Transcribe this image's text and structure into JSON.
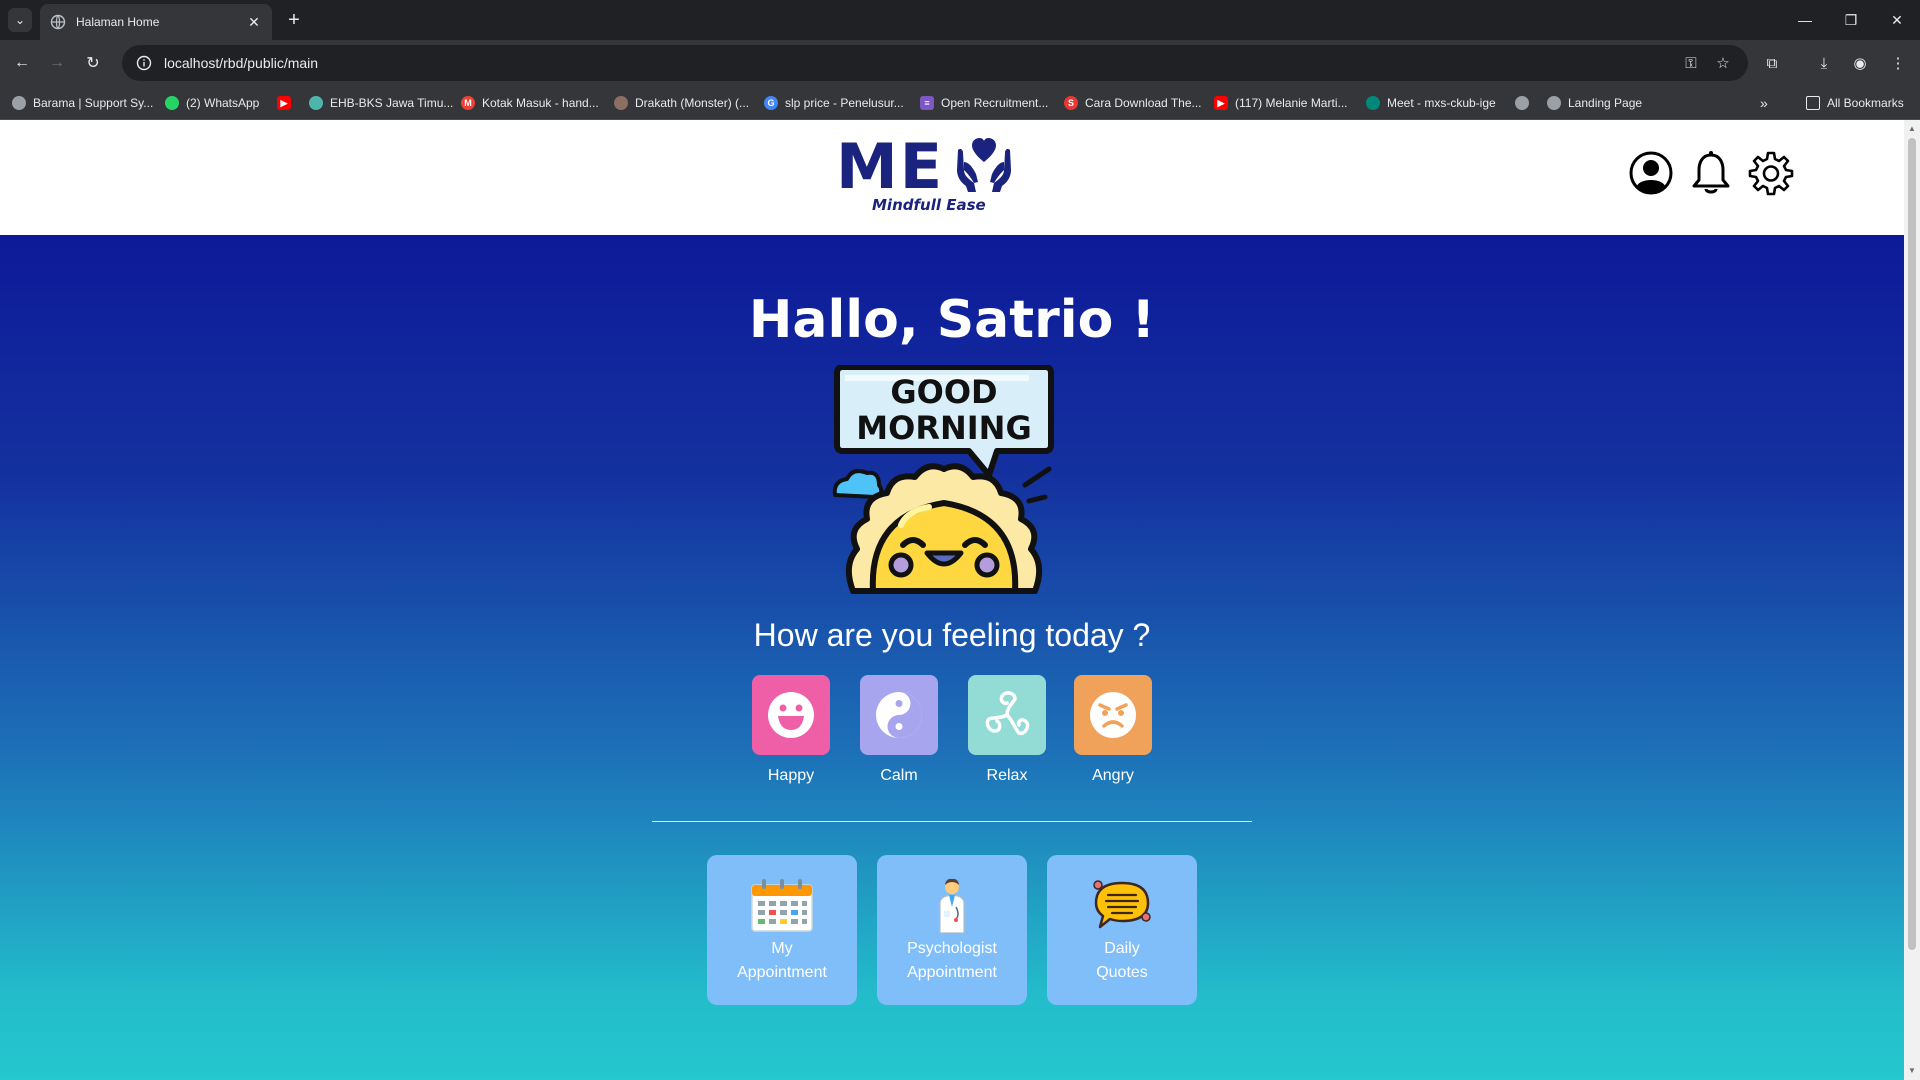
{
  "browser": {
    "tab_title": "Halaman Home",
    "new_tab": "+",
    "url": "localhost/rbd/public/main",
    "bookmarks": [
      {
        "label": "Barama | Support Sy...",
        "color": "#9aa0a6"
      },
      {
        "label": "(2) WhatsApp",
        "color": "#25d366"
      },
      {
        "label": "",
        "color": "#ff0000"
      },
      {
        "label": "EHB-BKS Jawa Timu...",
        "color": "#4db6ac"
      },
      {
        "label": "Kotak Masuk - hand...",
        "color": "#ea4335"
      },
      {
        "label": "Drakath (Monster) (...",
        "color": "#8d6e63"
      },
      {
        "label": "slp price - Penelusur...",
        "color": "#4285f4"
      },
      {
        "label": "Open Recruitment...",
        "color": "#7e57c2"
      },
      {
        "label": "Cara Download The...",
        "color": "#e53935"
      },
      {
        "label": "(117) Melanie Marti...",
        "color": "#ff0000"
      },
      {
        "label": "Meet - mxs-ckub-ige",
        "color": "#00897b"
      },
      {
        "label": "",
        "color": "#9aa0a6"
      },
      {
        "label": "Landing Page",
        "color": "#9aa0a6"
      }
    ],
    "bookmarks_overflow": "»",
    "all_bookmarks": "All Bookmarks"
  },
  "header": {
    "logo_text": "ME",
    "logo_tagline": "Mindfull Ease",
    "icons": [
      "user-icon",
      "bell-icon",
      "gear-icon"
    ],
    "brand_color": "#1a237e"
  },
  "main": {
    "greeting": "Hallo, Satrio !",
    "illustration_text": [
      "GOOD",
      "MORNING"
    ],
    "question": "How are you feeling today ?",
    "moods": [
      {
        "label": "Happy",
        "color": "#ee5fa7",
        "icon": "smile-icon"
      },
      {
        "label": "Calm",
        "color": "#a7a5ee",
        "icon": "yin-yang-icon"
      },
      {
        "label": "Relax",
        "color": "#93dcd6",
        "icon": "triskelion-icon"
      },
      {
        "label": "Angry",
        "color": "#f0a25a",
        "icon": "angry-face-icon"
      }
    ],
    "menu": [
      {
        "line1": "My",
        "line2": "Appointment",
        "icon": "calendar-icon"
      },
      {
        "line1": "Psychologist",
        "line2": "Appointment",
        "icon": "doctor-icon"
      },
      {
        "line1": "Daily",
        "line2": "Quotes",
        "icon": "speech-bubble-icon"
      }
    ]
  }
}
